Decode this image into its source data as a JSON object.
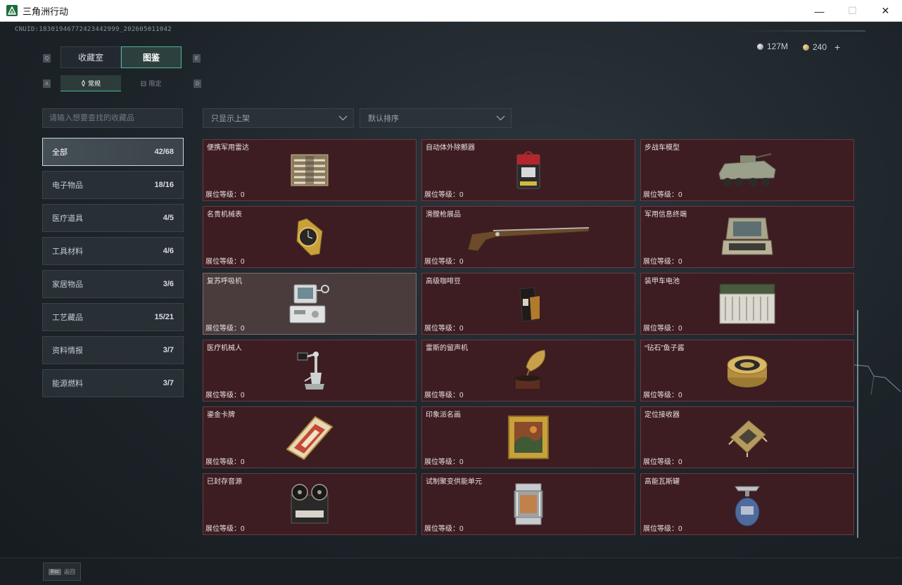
{
  "window": {
    "title": "三角洲行动",
    "minimize": "—",
    "maximize": "☐",
    "close": "✕"
  },
  "uid": "CNUID:18301946772423442999_202605011042",
  "currency": {
    "silver": "127M",
    "gold": "240",
    "add": "+"
  },
  "keys": {
    "prev_tab": "Q",
    "next_tab": "E",
    "prev_sub": "A",
    "next_sub": "D"
  },
  "tabs": [
    {
      "label": "收藏室",
      "active": false
    },
    {
      "label": "图鉴",
      "active": true
    }
  ],
  "sub_tabs": [
    {
      "label": "常规",
      "active": true
    },
    {
      "label": "限定",
      "active": false
    }
  ],
  "search": {
    "placeholder": "请输入想要查找的收藏品"
  },
  "filters": {
    "shelf": "只显示上架",
    "sort": "默认排序"
  },
  "categories": [
    {
      "label": "全部",
      "count": "42/68",
      "active": true
    },
    {
      "label": "电子物品",
      "count": "18/16",
      "active": false
    },
    {
      "label": "医疗道具",
      "count": "4/5",
      "active": false
    },
    {
      "label": "工具材料",
      "count": "4/6",
      "active": false
    },
    {
      "label": "家居物品",
      "count": "3/6",
      "active": false
    },
    {
      "label": "工艺藏品",
      "count": "15/21",
      "active": false
    },
    {
      "label": "资料情报",
      "count": "3/7",
      "active": false
    },
    {
      "label": "能源燃料",
      "count": "3/7",
      "active": false
    }
  ],
  "items": [
    {
      "name": "便携军用雷达",
      "level": "展位等级：0",
      "icon": "radar-icon"
    },
    {
      "name": "自动体外除颤器",
      "level": "展位等级：0",
      "icon": "defibrillator-icon"
    },
    {
      "name": "步战车模型",
      "level": "展位等级：0",
      "icon": "ifv-model-icon"
    },
    {
      "name": "名贵机械表",
      "level": "展位等级：0",
      "icon": "watch-icon"
    },
    {
      "name": "滑膛枪展品",
      "level": "展位等级：0",
      "icon": "musket-icon"
    },
    {
      "name": "军用信息终端",
      "level": "展位等级：0",
      "icon": "terminal-icon"
    },
    {
      "name": "复苏呼吸机",
      "level": "展位等级：0",
      "icon": "ventilator-icon"
    },
    {
      "name": "高级咖啡豆",
      "level": "展位等级：0",
      "icon": "coffee-bag-icon"
    },
    {
      "name": "装甲车电池",
      "level": "展位等级：0",
      "icon": "battery-icon"
    },
    {
      "name": "医疗机械人",
      "level": "展位等级：0",
      "icon": "medical-robot-icon"
    },
    {
      "name": "雷斯的留声机",
      "level": "展位等级：0",
      "icon": "gramophone-icon"
    },
    {
      "name": "“钻石”鱼子酱",
      "level": "展位等级：0",
      "icon": "caviar-tin-icon"
    },
    {
      "name": "鎏金卡牌",
      "level": "展位等级：0",
      "icon": "card-icon"
    },
    {
      "name": "印象派名画",
      "level": "展位等级：0",
      "icon": "painting-icon"
    },
    {
      "name": "定位接收器",
      "level": "展位等级：0",
      "icon": "receiver-icon"
    },
    {
      "name": "已封存音源",
      "level": "展位等级：0",
      "icon": "reel-recorder-icon"
    },
    {
      "name": "试制聚变供能单元",
      "level": "展位等级：0",
      "icon": "fusion-cell-icon"
    },
    {
      "name": "高能瓦斯罐",
      "level": "展位等级：0",
      "icon": "gas-canister-icon"
    }
  ],
  "footer": {
    "esc": "Esc",
    "back": "返回"
  },
  "colors": {
    "accent": "#4fb89a",
    "card_bg": "#3d1d22",
    "card_border": "#6a3a41",
    "card_highlight": "#4a3c3d"
  }
}
